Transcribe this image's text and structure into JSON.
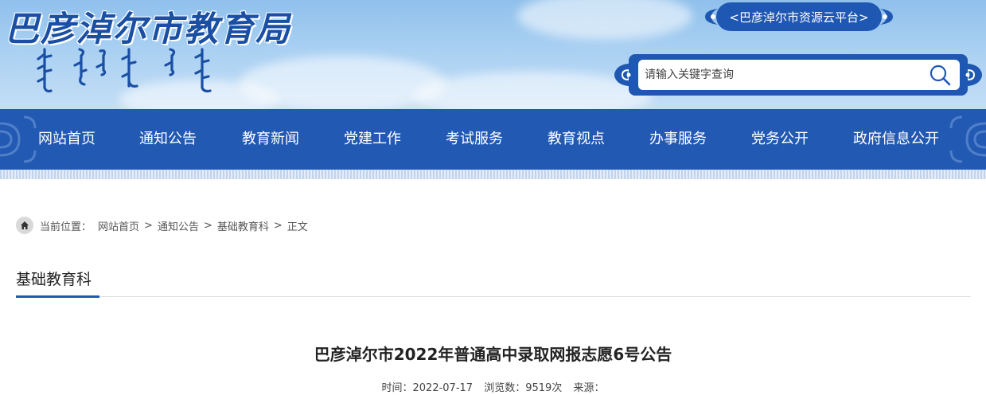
{
  "header": {
    "site_title": "巴彦淖尔市教育局",
    "platform_link": "<巴彦淖尔市资源云平台>",
    "search": {
      "placeholder": "请输入关键字查询"
    }
  },
  "nav": {
    "items": [
      "网站首页",
      "通知公告",
      "教育新闻",
      "党建工作",
      "考试服务",
      "教育视点",
      "办事服务",
      "党务公开",
      "政府信息公开"
    ]
  },
  "breadcrumb": {
    "prefix": "当前位置：",
    "items": [
      "网站首页",
      "通知公告",
      "基础教育科",
      "正文"
    ],
    "separator": ">"
  },
  "section": {
    "title": "基础教育科"
  },
  "article": {
    "title": "巴彦淖尔市2022年普通高中录取网报志愿6号公告",
    "time": "时间：2022-07-17",
    "views": "浏览数：9519次",
    "source": "来源："
  },
  "colors": {
    "primary": "#2259b3",
    "banner_sky": "#a9d0f2"
  },
  "icons": [
    "mongolian-script-logo",
    "search-icon",
    "home-icon",
    "ornament-icon"
  ]
}
